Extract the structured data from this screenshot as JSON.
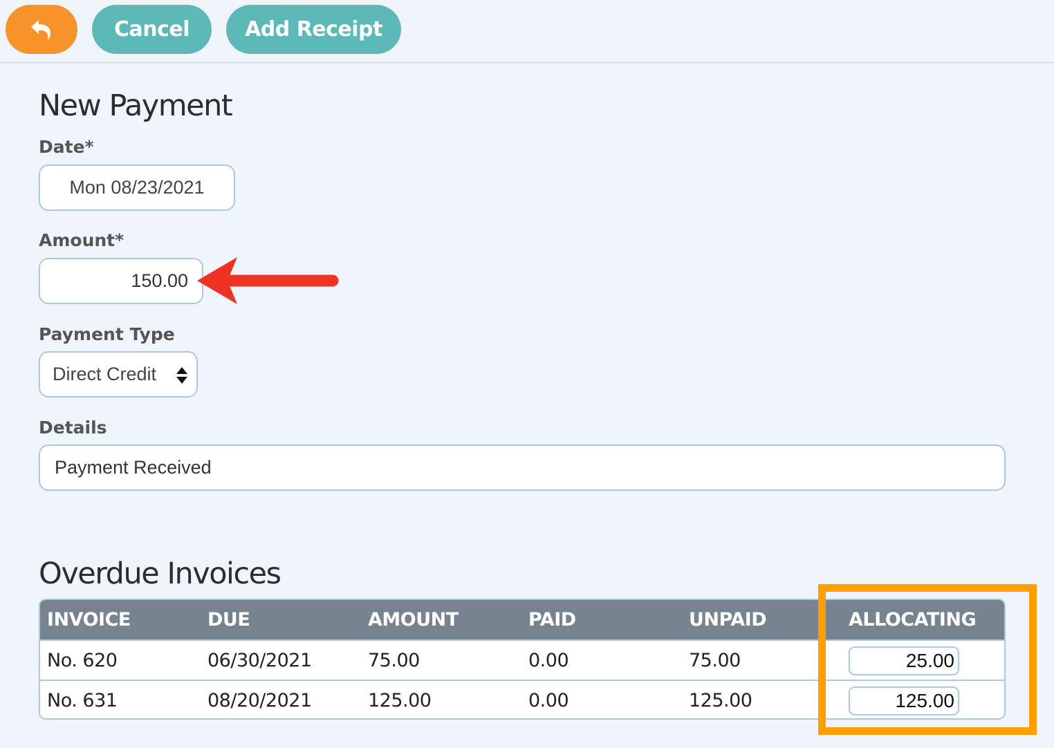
{
  "toolbar": {
    "back_icon": "undo-arrow-icon",
    "cancel_label": "Cancel",
    "add_receipt_label": "Add Receipt",
    "back_color": "#f8922a",
    "button_color": "#5db8b8"
  },
  "form": {
    "title": "New Payment",
    "date_label": "Date*",
    "date_value": "Mon 08/23/2021",
    "amount_label": "Amount*",
    "amount_value": "150.00",
    "payment_type_label": "Payment Type",
    "payment_type_value": "Direct Credit",
    "details_label": "Details",
    "details_value": "Payment Received"
  },
  "annotations": {
    "amount_arrow_color": "#ee3322",
    "allocating_highlight_color": "#ff9e00"
  },
  "invoices": {
    "title": "Overdue Invoices",
    "columns": [
      "INVOICE",
      "DUE",
      "AMOUNT",
      "PAID",
      "UNPAID",
      "ALLOCATING"
    ],
    "rows": [
      {
        "invoice": "No. 620",
        "due": "06/30/2021",
        "amount": "75.00",
        "paid": "0.00",
        "unpaid": "75.00",
        "allocating": "25.00"
      },
      {
        "invoice": "No. 631",
        "due": "08/20/2021",
        "amount": "125.00",
        "paid": "0.00",
        "unpaid": "125.00",
        "allocating": "125.00"
      }
    ]
  }
}
